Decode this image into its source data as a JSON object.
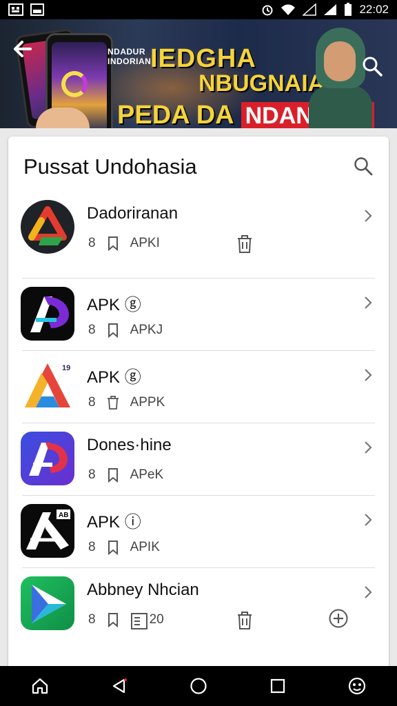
{
  "status_bar": {
    "time": "22:02",
    "left_icons": [
      "notification-icon",
      "image-icon"
    ],
    "right_icons": [
      "alarm-icon",
      "wifi-icon",
      "signal-icon",
      "signal-icon-2",
      "battery-icon"
    ]
  },
  "banner": {
    "small_text": "NDADUR\nINDORIAN",
    "line1": "IEDGHA",
    "line2": "NBUGNAIA",
    "line3_text": "PEDA DA",
    "line3_tag": "NDANOSIA",
    "colors": {
      "headline": "#f5d33a",
      "tag_bg": "#d9202a"
    }
  },
  "card": {
    "title": "Pussat Undohasia"
  },
  "apps": [
    {
      "title": "Dadoriranan",
      "count": "8",
      "label": "APKI"
    },
    {
      "title": "APK ⓖ",
      "count": "8",
      "label": "APKJ"
    },
    {
      "title": "APK ⓖ",
      "count": "8",
      "label": "APPK",
      "badge": "19"
    },
    {
      "title": "Dones·hine",
      "count": "8",
      "label": "APeK"
    },
    {
      "title": "APK ⓘ",
      "count": "8",
      "label": "APIK",
      "badge": "AB"
    },
    {
      "title": "Abbney Nhcian",
      "count": "8",
      "extra": "20"
    }
  ],
  "nav_bar": {
    "icons": [
      "home-icon",
      "back-icon",
      "circle-home-icon",
      "recents-icon",
      "assistant-icon"
    ]
  }
}
